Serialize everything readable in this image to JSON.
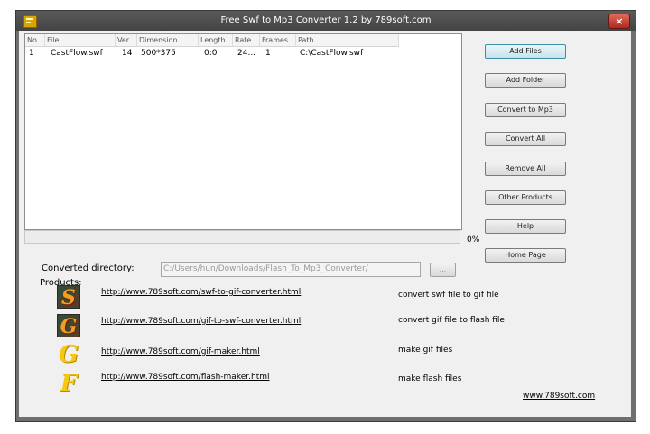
{
  "window": {
    "title": "Free Swf to Mp3 Converter 1.2 by 789soft.com",
    "close_label": "×"
  },
  "file_list": {
    "columns": [
      "No",
      "File",
      "Ver",
      "Dimension",
      "Length",
      "Rate",
      "Frames",
      "Path"
    ],
    "rows": [
      {
        "no": "1",
        "file": "CastFlow.swf",
        "ver": "14",
        "dimension": "500*375",
        "length": "0:0",
        "rate": "24...",
        "frames": "1",
        "path": "C:\\CastFlow.swf"
      }
    ]
  },
  "progress": {
    "percent_label": "0%",
    "value": 0
  },
  "buttons": {
    "add_files": "Add Files",
    "add_folder": "Add Folder",
    "convert_to_mp3": "Convert to Mp3",
    "convert_all": "Convert All",
    "remove_all": "Remove All",
    "other_products": "Other Products",
    "help": "Help",
    "home_page": "Home Page",
    "browse": "..."
  },
  "converted_directory": {
    "label": "Converted directory:",
    "value": "C:/Users/hun/Downloads/Flash_To_Mp3_Converter/"
  },
  "products": {
    "label": "Products:",
    "items": [
      {
        "icon": "S",
        "icon_name": "swf-to-gif-icon",
        "url": "http://www.789soft.com/swf-to-gif-converter.html",
        "desc": "convert swf file to gif file"
      },
      {
        "icon": "G",
        "icon_name": "gif-to-swf-icon",
        "url": "http://www.789soft.com/gif-to-swf-converter.html",
        "desc": "convert gif file to flash file"
      },
      {
        "icon": "G",
        "icon_name": "gif-maker-icon",
        "url": "http://www.789soft.com/gif-maker.html",
        "desc": "make gif files"
      },
      {
        "icon": "F",
        "icon_name": "flash-maker-icon",
        "url": "http://www.789soft.com/flash-maker.html",
        "desc": "make flash files"
      }
    ]
  },
  "site_link": "www.789soft.com",
  "colors": {
    "title_bar": "#4a4a4a",
    "frame": "#6f6f6f",
    "client_bg": "#f0f0f0",
    "close_button": "#c23a2c",
    "progress_fill": "#3fa23f"
  }
}
